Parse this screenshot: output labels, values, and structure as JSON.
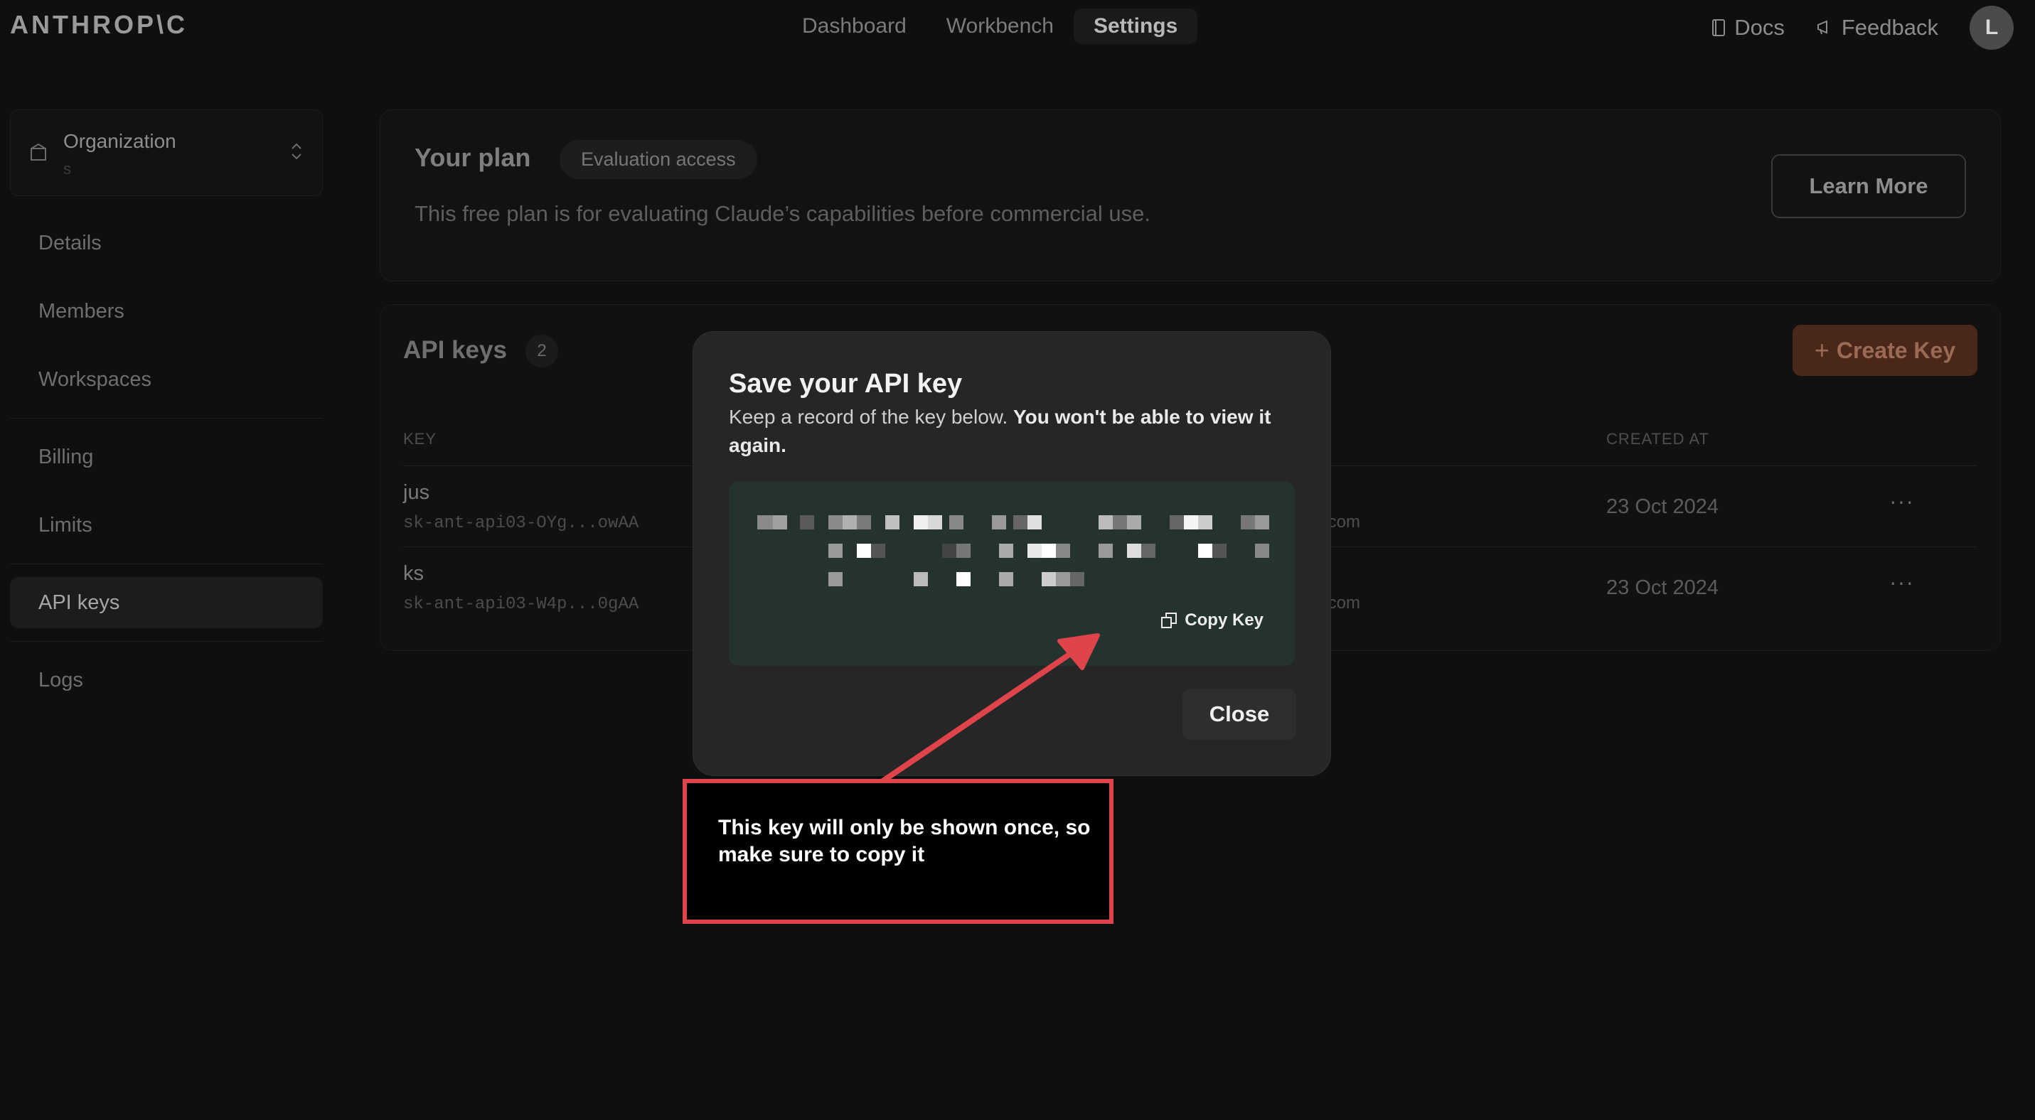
{
  "brand": {
    "logo_text": "ANTHROP\\C"
  },
  "topnav": {
    "items": [
      "Dashboard",
      "Workbench",
      "Settings"
    ],
    "active": "Settings"
  },
  "topright": {
    "docs": "Docs",
    "feedback": "Feedback",
    "avatar_initial": "L"
  },
  "sidebar": {
    "org_label": "Organization",
    "org_sub": "s",
    "items": [
      "Details",
      "Members",
      "Workspaces",
      "Billing",
      "Limits",
      "API keys",
      "Logs"
    ],
    "active": "API keys"
  },
  "plan": {
    "title": "Your plan",
    "badge": "Evaluation access",
    "description": "This free plan is for evaluating Claude’s capabilities before commercial use.",
    "learn_more": "Learn More"
  },
  "api_keys": {
    "title": "API keys",
    "count": "2",
    "create_label": "Create Key",
    "columns": {
      "key": "KEY",
      "created": "CREATED AT"
    },
    "rows": [
      {
        "name": "jus",
        "key": "sk-ant-api03-OYg...owAA",
        "email_tail": "ail.com",
        "created": "23 Oct 2024",
        "more": "···"
      },
      {
        "name": "ks",
        "key": "sk-ant-api03-W4p...0gAA",
        "email_tail": "ail.com",
        "created": "23 Oct 2024",
        "more": "···"
      }
    ]
  },
  "modal": {
    "title": "Save your API key",
    "desc_plain": "Keep a record of the key below. ",
    "desc_bold": "You won't be able to view it again.",
    "copy_label": "Copy Key",
    "close_label": "Close"
  },
  "callout": {
    "text": "This key will only be shown once, so make sure to copy it"
  },
  "colors": {
    "callout_border": "#e0444b",
    "keybox_bg": "#24332e",
    "create_button_bg": "#4a2819"
  }
}
